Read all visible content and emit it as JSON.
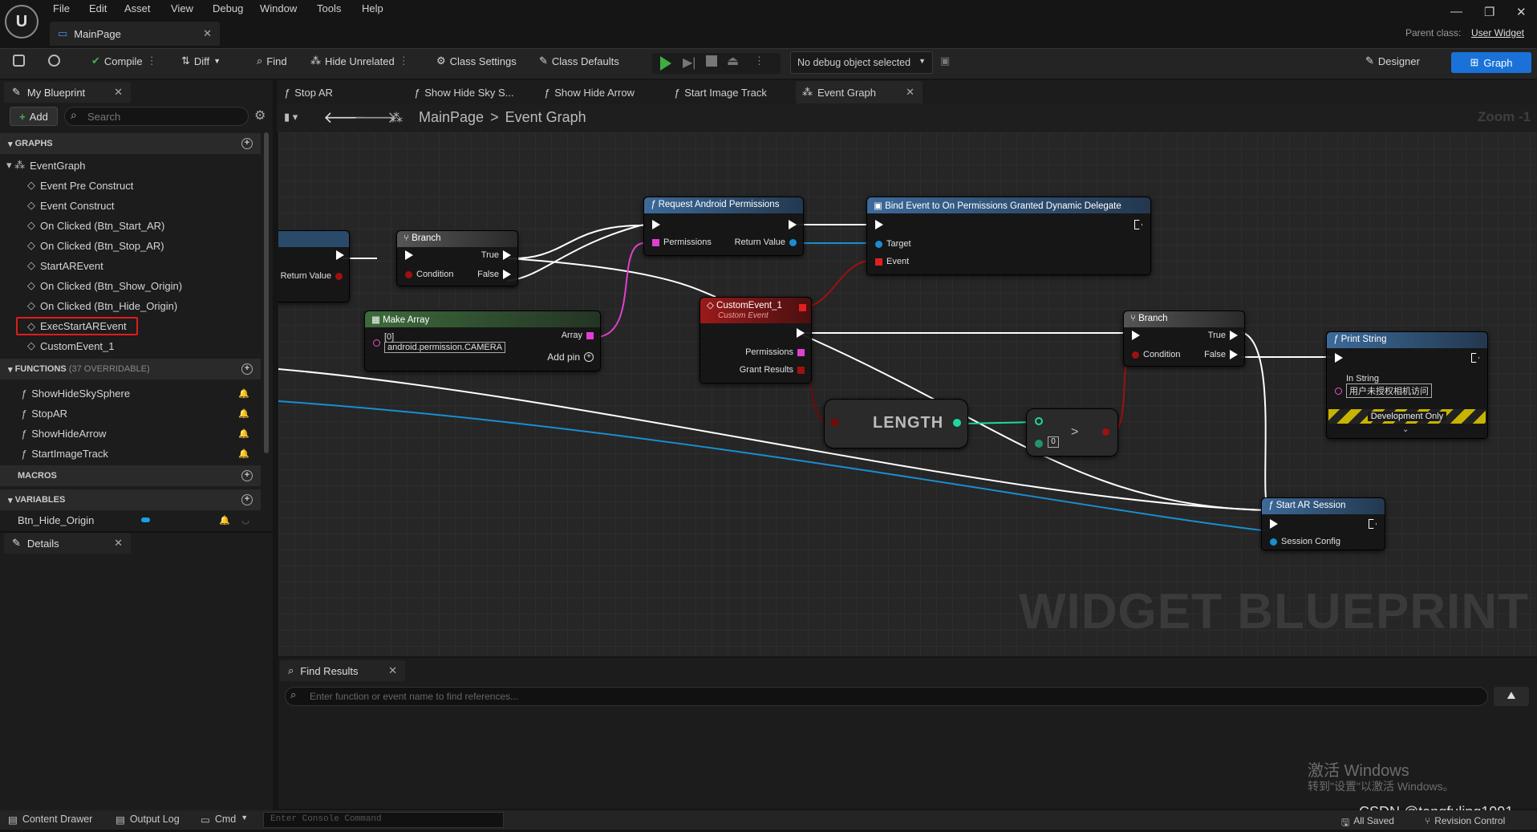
{
  "menu": [
    "File",
    "Edit",
    "Asset",
    "View",
    "Debug",
    "Window",
    "Tools",
    "Help"
  ],
  "doc_tab": "MainPage",
  "parent_class": {
    "label": "Parent class:",
    "value": "User Widget"
  },
  "toolbar": {
    "compile": "Compile",
    "diff": "Diff",
    "find": "Find",
    "hide_unrelated": "Hide Unrelated",
    "class_settings": "Class Settings",
    "class_defaults": "Class Defaults",
    "debug_object": "No debug object selected",
    "designer": "Designer",
    "graph": "Graph"
  },
  "left": {
    "tab": "My Blueprint",
    "add": "Add",
    "search_placeholder": "Search",
    "graphs_header": "GRAPHS",
    "event_graph": "EventGraph",
    "events": [
      "Event Pre Construct",
      "Event Construct",
      "On Clicked (Btn_Start_AR)",
      "On Clicked (Btn_Stop_AR)",
      "StartAREvent",
      "On Clicked (Btn_Show_Origin)",
      "On Clicked (Btn_Hide_Origin)",
      "ExecStartAREvent",
      "CustomEvent_1"
    ],
    "functions_header": "FUNCTIONS",
    "functions_count": "(37 OVERRIDABLE)",
    "functions": [
      "ShowHideSkySphere",
      "StopAR",
      "ShowHideArrow",
      "StartImageTrack"
    ],
    "macros_header": "MACROS",
    "variables_header": "VARIABLES",
    "variables": [
      "Btn_Hide_Origin"
    ],
    "details_tab": "Details"
  },
  "graph_tabs": [
    "Stop AR",
    "Show Hide Sky S...",
    "Show Hide Arrow",
    "Start Image Track",
    "Event Graph"
  ],
  "breadcrumb": {
    "root": "MainPage",
    "sep": ">",
    "current": "Event Graph"
  },
  "zoom": "Zoom -1",
  "nodes": {
    "return_value": "Return Value",
    "branch1": {
      "title": "Branch",
      "true": "True",
      "false": "False",
      "condition": "Condition"
    },
    "make_array": {
      "title": "Make Array",
      "index": "[0]",
      "value": "android.permission.CAMERA",
      "array": "Array",
      "add_pin": "Add pin"
    },
    "request": {
      "title": "Request Android Permissions",
      "permissions": "Permissions",
      "return": "Return Value"
    },
    "bind": {
      "title": "Bind Event to On Permissions Granted Dynamic Delegate",
      "target": "Target",
      "event": "Event"
    },
    "custom_event": {
      "title": "CustomEvent_1",
      "subtitle": "Custom Event",
      "permissions": "Permissions",
      "grant": "Grant Results"
    },
    "length": "LENGTH",
    "compare": {
      "op": ">",
      "value": "0"
    },
    "branch2": {
      "title": "Branch",
      "true": "True",
      "false": "False",
      "condition": "Condition"
    },
    "print": {
      "title": "Print String",
      "in_string": "In String",
      "value": "用户未授权相机访问",
      "dev": "Development Only"
    },
    "start_ar": {
      "title": "Start AR Session",
      "config": "Session Config"
    }
  },
  "watermark": "WIDGET BLUEPRINT",
  "find": {
    "tab": "Find Results",
    "placeholder": "Enter function or event name to find references..."
  },
  "activate": {
    "line1": "激活 Windows",
    "line2": "转到\"设置\"以激活 Windows。"
  },
  "csdn": "CSDN @tangfuling1991",
  "status": {
    "content_drawer": "Content Drawer",
    "output_log": "Output Log",
    "cmd": "Cmd",
    "console_placeholder": "Enter Console Command",
    "all_saved": "All Saved",
    "revision": "Revision Control"
  },
  "colors": {
    "accent": "#1a72d8",
    "exec": "#ffffff",
    "bool": "#a01010",
    "object": "#00a8f0",
    "array": "#e040d0",
    "int": "#1fd8a0",
    "string": "#f050c0"
  }
}
